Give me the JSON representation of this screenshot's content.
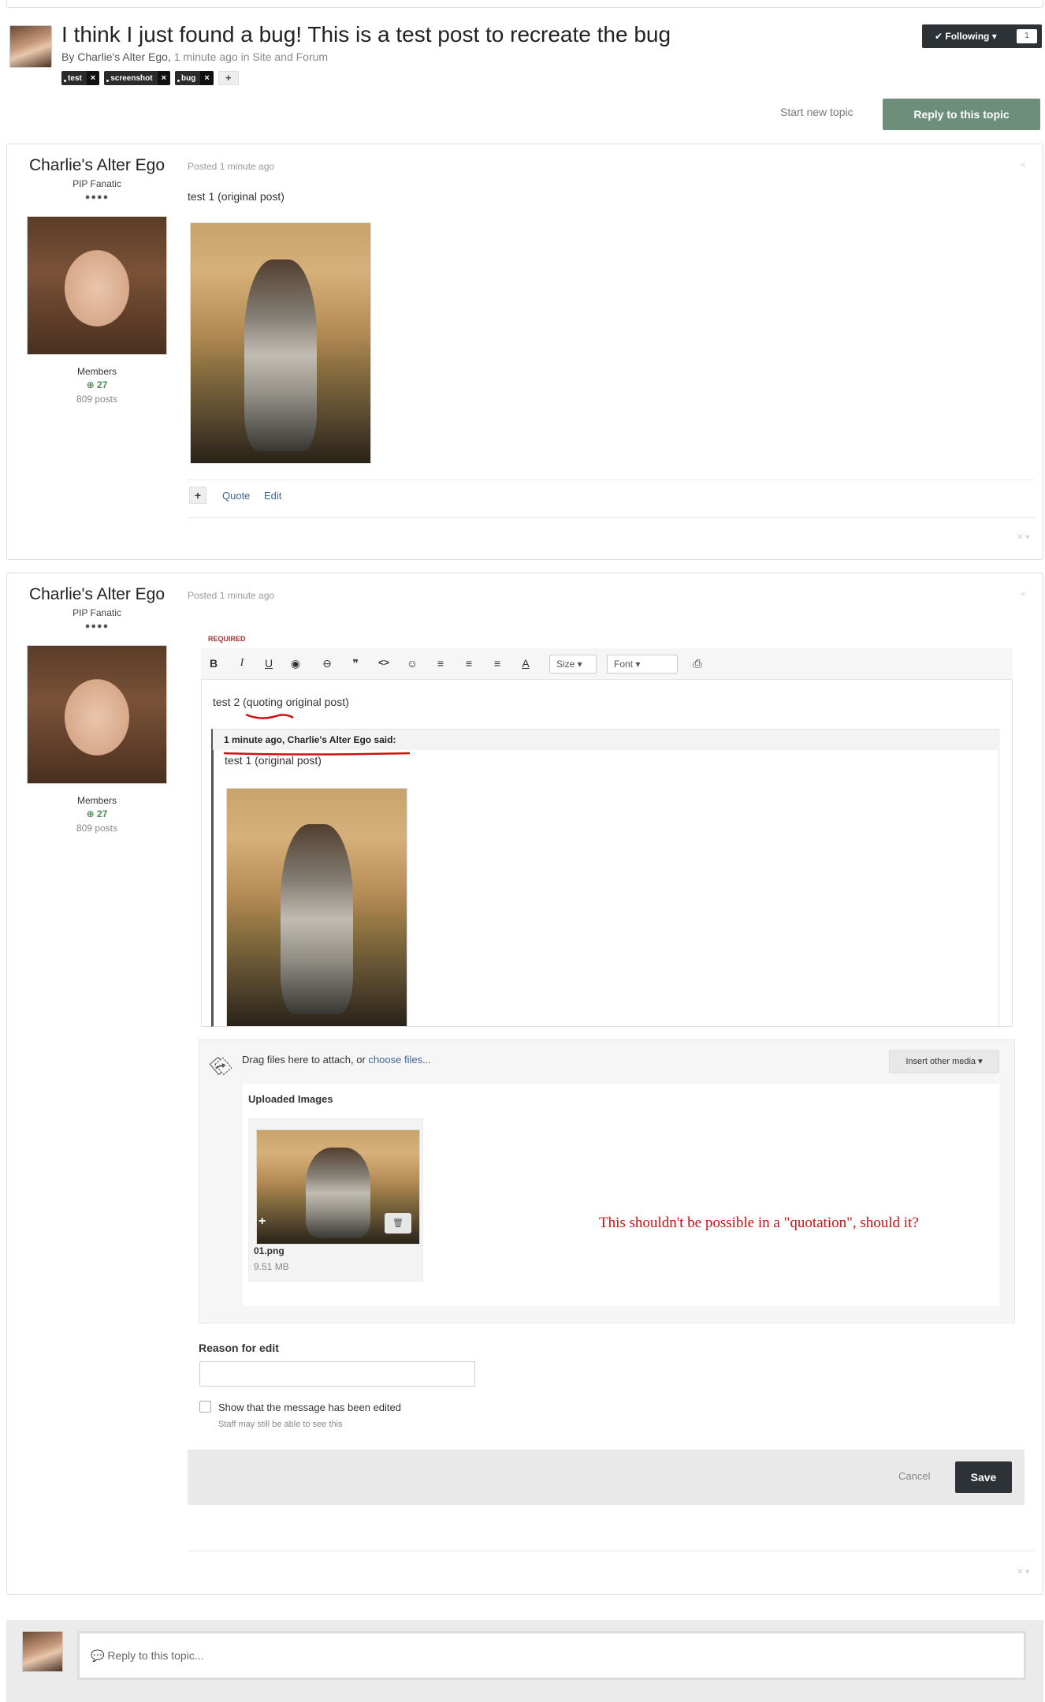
{
  "topic": {
    "title": "I think I just found a bug! This is a test post to recreate the bug",
    "by_prefix": "By",
    "author": "Charlie's Alter Ego,",
    "meta": " 1 minute ago in Site and Forum",
    "tags": [
      "test",
      "screenshot",
      "bug"
    ],
    "tag_remove": "×",
    "tag_add": "+",
    "following_label": "✔ Following ▾",
    "following_count": "1",
    "start_new_topic": "Start new topic",
    "reply_to_topic": "Reply to this topic"
  },
  "author": {
    "name": "Charlie's Alter Ego",
    "rank": "PIP Fanatic",
    "pips": "●●●●",
    "group": "Members",
    "reputation": "⊕ 27",
    "posts": "809 posts"
  },
  "post1": {
    "posted": "Posted 1 minute ago",
    "text": "test 1 (original post)",
    "plus": "+",
    "quote": "Quote",
    "edit": "Edit"
  },
  "post2": {
    "posted": "Posted 1 minute ago",
    "required": "REQUIRED",
    "toolbar": {
      "bold": "B",
      "italic": "I",
      "underline": "U",
      "eye": "◉",
      "link": "⊖",
      "quote": "❞",
      "code": "<>",
      "emoji": "☺",
      "align_left": "≡",
      "align_center": "≡",
      "align_right": "≡",
      "color": "A",
      "size": "Size",
      "font": "Font",
      "preview": "⎙"
    },
    "editor_text": "test 2 (quoting original post)",
    "quote_header": "1 minute ago, Charlie's Alter Ego said:",
    "quote_text": "test 1 (original post)",
    "drag_text": "Drag files here to attach, or ",
    "choose_files": "choose files...",
    "insert_media": "Insert other media ▾",
    "uploaded_title": "Uploaded Images",
    "file_name": "01.png",
    "file_size": "9.51 MB",
    "thumb_plus": "+",
    "trash": "🗑",
    "reason_label": "Reason for edit",
    "show_edited": "Show that the message has been edited",
    "staff_note": "Staff may still be able to see this",
    "cancel": "Cancel",
    "save": "Save"
  },
  "annotation": {
    "text": "This shouldn't be possible in a \"quotation\", should it?",
    "color": "#d01010"
  },
  "reply": {
    "placeholder": "💬 Reply to this topic..."
  },
  "colors": {
    "accent_green": "#6d8e7a",
    "dark_button": "#2d3237",
    "link": "#3d6594"
  }
}
